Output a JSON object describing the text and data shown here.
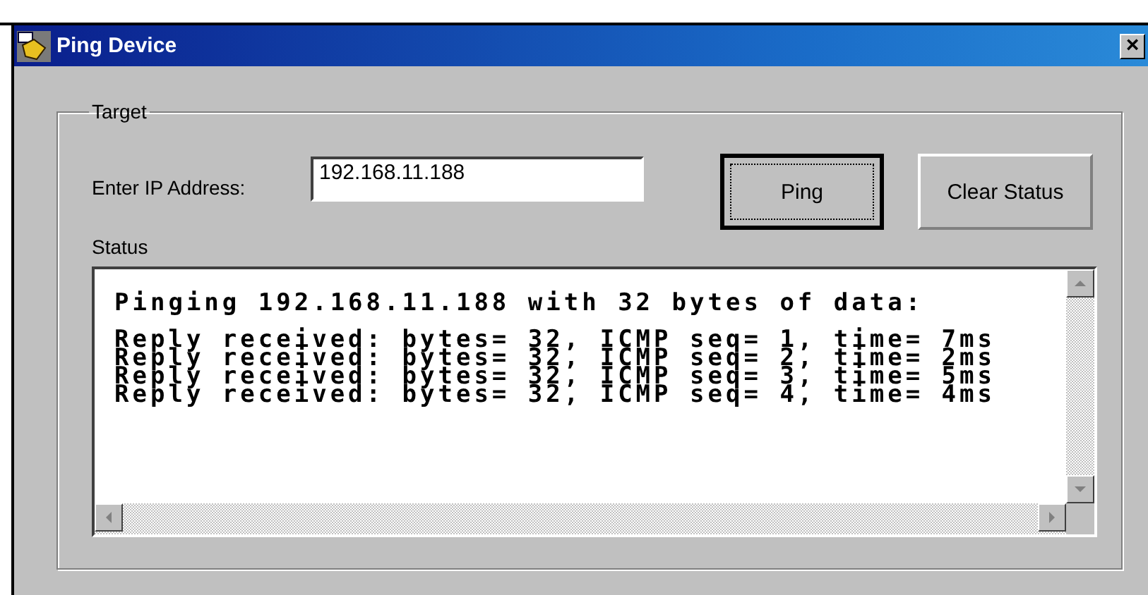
{
  "window": {
    "title": "Ping Device",
    "close": "×"
  },
  "group": {
    "label": "Target"
  },
  "ip": {
    "label": "Enter IP Address:",
    "value": "192.168.11.188"
  },
  "buttons": [
    {
      "label": "Ping",
      "focused": true
    },
    {
      "label": "Clear Status",
      "focused": false
    }
  ],
  "status": {
    "label": "Status",
    "header": "Pinging 192.168.11.188 with 32 bytes of data:",
    "lines": [
      "Reply received: bytes= 32, ICMP seq= 1, time= 7ms",
      "Reply received: bytes= 32, ICMP seq= 2, time= 2ms",
      "Reply received: bytes= 32, ICMP seq= 3, time= 5ms",
      "Reply received: bytes= 32, ICMP seq= 4, time= 4ms"
    ]
  }
}
